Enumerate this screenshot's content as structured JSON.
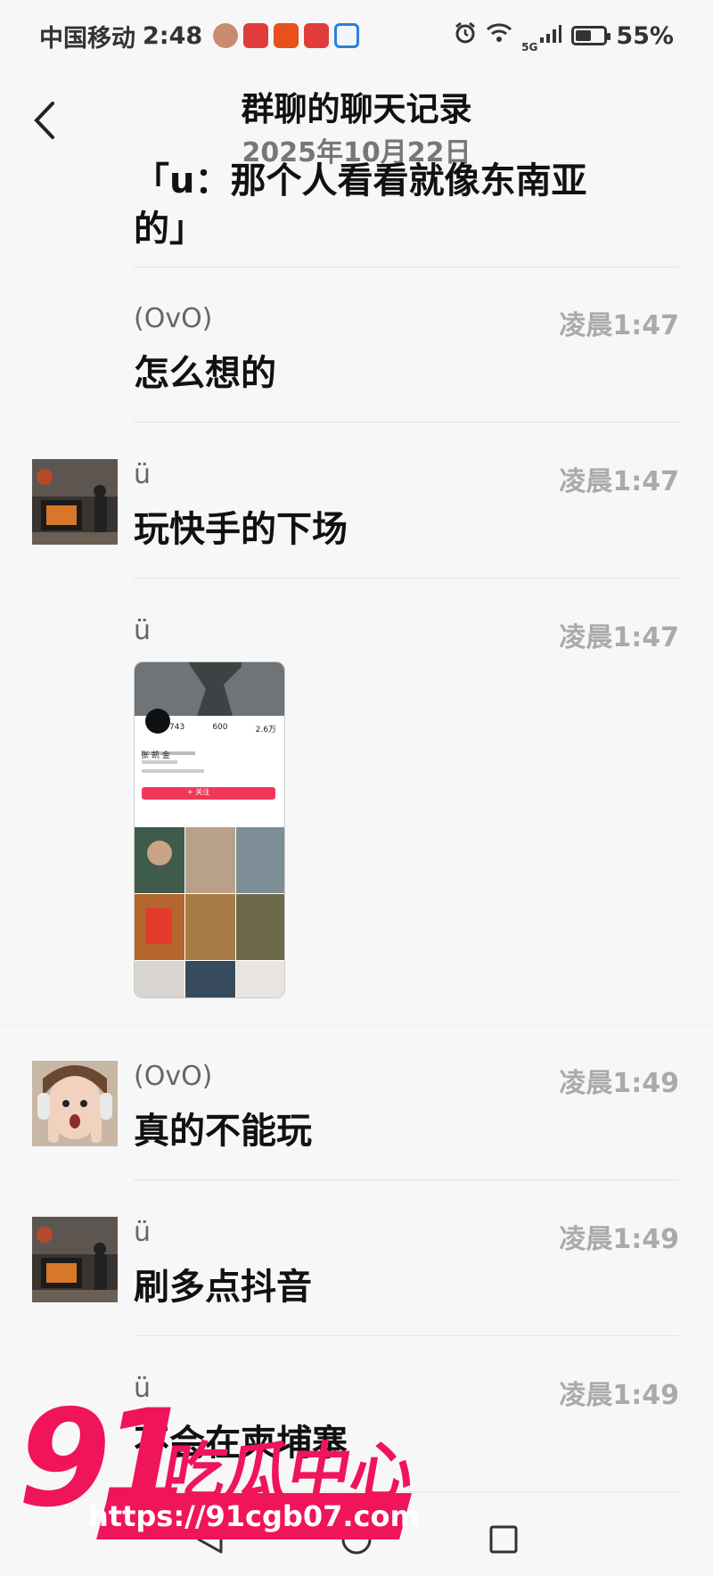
{
  "status_bar": {
    "carrier": "中国移动",
    "time": "2:48",
    "network": "5G",
    "battery": "55%",
    "battery_level": 0.55
  },
  "header": {
    "title": "群聊的聊天记录",
    "date": "2025年10月22日"
  },
  "messages": [
    {
      "sender": "",
      "time": "",
      "text": "「u：那个人看看就像东南亚的」",
      "avatar": ""
    },
    {
      "sender": "(OvO)",
      "time": "凌晨1:47",
      "text": "怎么想的",
      "avatar": ""
    },
    {
      "sender": "ü",
      "time": "凌晨1:47",
      "text": "玩快手的下场",
      "avatar": "fireplace-photo"
    },
    {
      "sender": "ü",
      "time": "凌晨1:47",
      "text": "",
      "avatar": "",
      "image": "profile-screenshot"
    },
    {
      "sender": "(OvO)",
      "time": "凌晨1:49",
      "text": "真的不能玩",
      "avatar": "surprised-girl-photo"
    },
    {
      "sender": "ü",
      "time": "凌晨1:49",
      "text": "刷多点抖音",
      "avatar": "fireplace-photo"
    },
    {
      "sender": "ü",
      "time": "凌晨1:49",
      "text": "不会在柬埔寨",
      "avatar": ""
    }
  ],
  "screenshot_profile": {
    "stats": [
      "743",
      "600",
      "2.6万"
    ],
    "name": "张 凯 金",
    "follow_button": "+ 关注"
  },
  "watermark": {
    "number": "91",
    "text": "吃瓜中心",
    "url": "https://91cgb07.com"
  },
  "colors": {
    "background": "#f7f7f7",
    "watermark": "#f0145a"
  }
}
